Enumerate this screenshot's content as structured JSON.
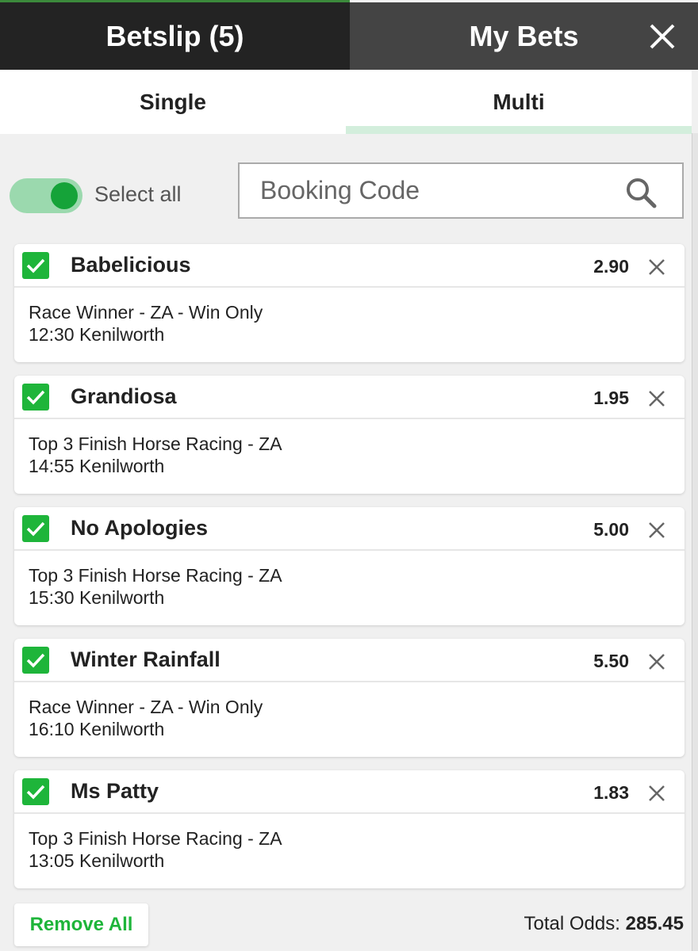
{
  "header": {
    "betslip_label": "Betslip (5)",
    "mybets_label": "My Bets",
    "close_icon": "close-icon"
  },
  "subtabs": [
    {
      "label": "Single",
      "active": false
    },
    {
      "label": "Multi",
      "active": true
    }
  ],
  "select_all": {
    "label": "Select all",
    "on": true
  },
  "booking": {
    "placeholder": "Booking Code",
    "value": "",
    "icon": "search-icon"
  },
  "selections": [
    {
      "name": "Babelicious",
      "odds": "2.90",
      "market": "Race Winner - ZA - Win Only",
      "event": "12:30 Kenilworth",
      "checked": true
    },
    {
      "name": "Grandiosa",
      "odds": "1.95",
      "market": "Top 3 Finish Horse Racing - ZA",
      "event": "14:55 Kenilworth",
      "checked": true
    },
    {
      "name": "No Apologies",
      "odds": "5.00",
      "market": "Top 3 Finish Horse Racing - ZA",
      "event": "15:30 Kenilworth",
      "checked": true
    },
    {
      "name": "Winter Rainfall",
      "odds": "5.50",
      "market": "Race Winner - ZA - Win Only",
      "event": "16:10 Kenilworth",
      "checked": true
    },
    {
      "name": "Ms Patty",
      "odds": "1.83",
      "market": "Top 3 Finish Horse Racing - ZA",
      "event": "13:05 Kenilworth",
      "checked": true
    }
  ],
  "footer": {
    "remove_all_label": "Remove All",
    "total_odds_label": "Total Odds:",
    "total_odds_value": "285.45"
  },
  "colors": {
    "accent": "#1eb53a",
    "header_dark": "#232323",
    "header_mid": "#444444",
    "tab_indicator": "#d3eedc"
  }
}
